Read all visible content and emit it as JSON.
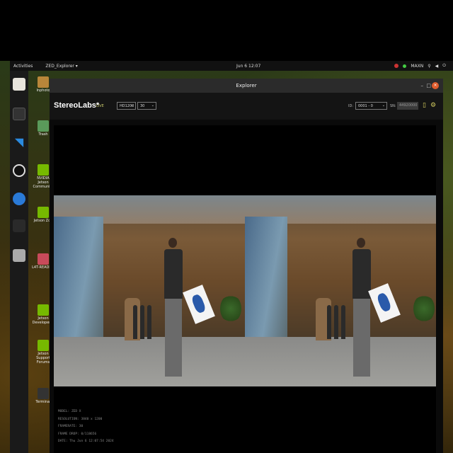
{
  "topbar": {
    "activities": "Activities",
    "app_menu": "ZED_Explorer ▾",
    "clock": "Jun 6 12:07",
    "power_mode": "MAXN"
  },
  "desktop_icons": [
    {
      "label": "Inphoto"
    },
    {
      "label": "Trash"
    },
    {
      "label": "NVIDIA Jetson Community"
    },
    {
      "label": "Jetson Zoo"
    },
    {
      "label": "L4T-README"
    },
    {
      "label": "Jetson Developer Z"
    },
    {
      "label": "Jetson Support Forums"
    },
    {
      "label": "Terminal"
    }
  ],
  "window": {
    "title": "Explorer",
    "logo": "StereoLabs*",
    "live_badge": "LIVE",
    "resolution_select": "HD1200",
    "fps_select": "30",
    "id_label": "ID:",
    "camera_select": "0001 - 0",
    "sn_label": "SN:",
    "sn_value": "44920000"
  },
  "colors": {
    "accent": "#d8d060",
    "close": "#e05c2c",
    "titlebar": "#2b2b2b"
  },
  "metadata": {
    "model": "MODEL: ZED X",
    "resolution": "RESOLUTION: 3840 x 1200",
    "framerate": "FRAMERATE: 30",
    "frame_drop": "FRAME DROP: 0/118656",
    "date": "DATE: Thu Jun 6 12:07:54 2024"
  }
}
